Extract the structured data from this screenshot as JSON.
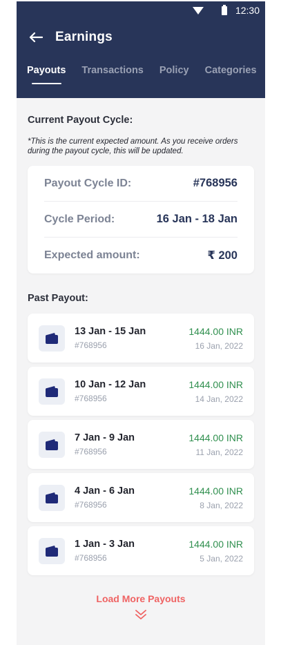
{
  "status_bar": {
    "time": "12:30",
    "wifi_icon": "wifi-icon",
    "battery_icon": "battery-icon"
  },
  "header": {
    "title": "Earnings",
    "back_icon": "arrow-left-icon",
    "tabs": [
      {
        "label": "Payouts",
        "active": true
      },
      {
        "label": "Transactions",
        "active": false
      },
      {
        "label": "Policy",
        "active": false
      },
      {
        "label": "Categories",
        "active": false
      }
    ],
    "background_color": "#283559"
  },
  "current_cycle": {
    "section_title": "Current Payout Cycle:",
    "note": "*This  is the current expected amount. As you receive orders during the payout cycle, this will be updated.",
    "rows": [
      {
        "label": "Payout Cycle ID:",
        "value": "#768956"
      },
      {
        "label": "Cycle Period:",
        "value": "16 Jan - 18 Jan"
      },
      {
        "label": "Expected amount:",
        "value": "₹ 200"
      }
    ]
  },
  "past_payouts": {
    "section_title": "Past Payout:",
    "items": [
      {
        "range": "13 Jan - 15 Jan",
        "id": "#768956",
        "amount": "1444.00 INR",
        "date": "16 Jan, 2022"
      },
      {
        "range": "10 Jan - 12 Jan",
        "id": "#768956",
        "amount": "1444.00 INR",
        "date": "14 Jan, 2022"
      },
      {
        "range": "7 Jan - 9 Jan",
        "id": "#768956",
        "amount": "1444.00 INR",
        "date": "11 Jan, 2022"
      },
      {
        "range": "4 Jan - 6 Jan",
        "id": "#768956",
        "amount": "1444.00 INR",
        "date": "8 Jan, 2022"
      },
      {
        "range": "1 Jan - 3 Jan",
        "id": "#768956",
        "amount": "1444.00 INR",
        "date": "5 Jan, 2022"
      }
    ],
    "item_icon": "wallet-icon",
    "amount_color": "#2f8f4e"
  },
  "load_more": {
    "label": "Load More Payouts",
    "icon": "double-chevron-down-icon",
    "color": "#ef6363"
  }
}
